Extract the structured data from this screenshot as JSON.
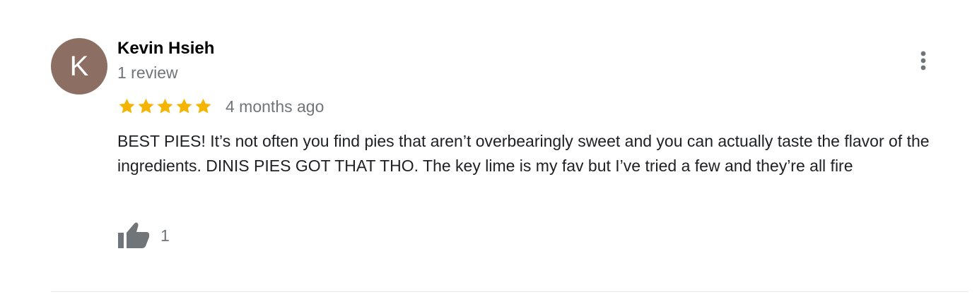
{
  "review": {
    "avatar_initial": "K",
    "author_name": "Kevin Hsieh",
    "review_count": "1 review",
    "rating": 5,
    "rating_max": 5,
    "date": "4 months ago",
    "text": "BEST PIES! It’s not often you find pies that aren’t overbearingly sweet and you can actually taste the flavor of the ingredients. DINIS PIES GOT THAT THO. The key lime is my fav but I’ve tried a few and they’re all fire",
    "like_count": "1"
  },
  "colors": {
    "avatar_bg": "#8d6e63",
    "star": "#f4b400",
    "secondary_text": "#70757a",
    "icon": "#70757a",
    "divider": "#e8eaed"
  },
  "icons": {
    "more": "more-vert-icon",
    "star": "star-icon",
    "like": "thumbs-up-icon"
  }
}
